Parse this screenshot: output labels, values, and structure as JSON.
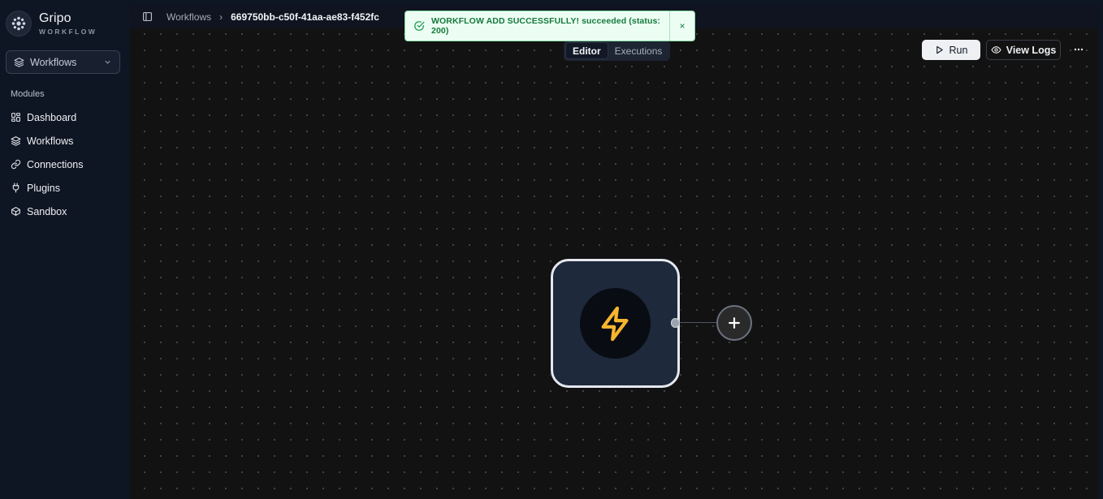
{
  "brand": {
    "name": "Gripo",
    "subtitle": "WORKFLOW"
  },
  "workspace_select": {
    "value": "Workflows"
  },
  "sidebar": {
    "section_title": "Modules",
    "items": [
      {
        "label": "Dashboard",
        "icon": "dashboard-icon"
      },
      {
        "label": "Workflows",
        "icon": "layers-icon"
      },
      {
        "label": "Connections",
        "icon": "link-icon"
      },
      {
        "label": "Plugins",
        "icon": "plug-icon"
      },
      {
        "label": "Sandbox",
        "icon": "box-icon"
      }
    ]
  },
  "breadcrumb": {
    "parent": "Workflows",
    "current": "669750bb-c50f-41aa-ae83-f452fc"
  },
  "toast": {
    "message": "WORKFLOW ADD SUCCESSFULLY! succeeded (status: 200)",
    "close": "×"
  },
  "tabs": [
    {
      "label": "Editor",
      "active": true
    },
    {
      "label": "Executions",
      "active": false
    }
  ],
  "actions": {
    "run": "Run",
    "view_logs": "View Logs"
  },
  "canvas": {
    "trigger_node_icon": "lightning-icon",
    "add_node_icon": "plus-icon"
  },
  "colors": {
    "accent_trigger": "#f5b52e",
    "toast_bg": "#ecfdf3",
    "toast_text": "#157a3c"
  }
}
